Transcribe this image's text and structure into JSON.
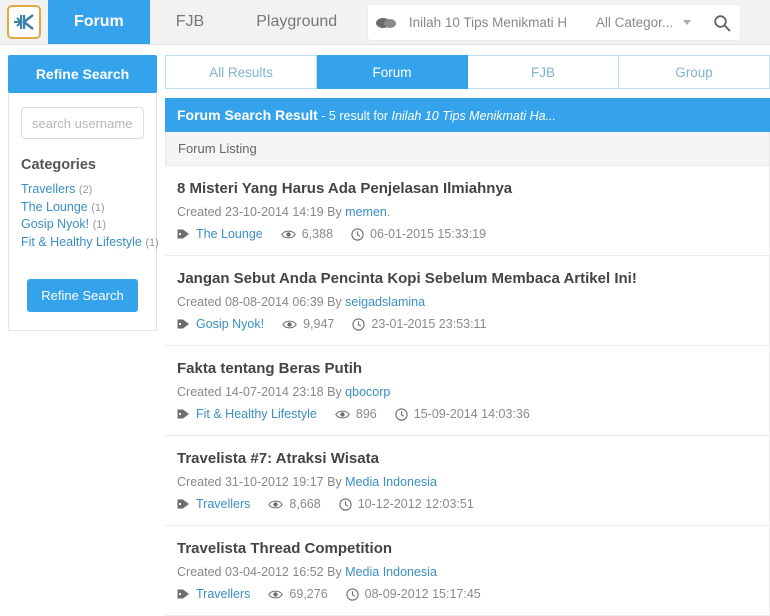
{
  "topnav": {
    "logo_alt": "kaskus-logo",
    "items": [
      {
        "label": "Forum",
        "active": true
      },
      {
        "label": "FJB",
        "active": false
      },
      {
        "label": "Playground",
        "active": false
      }
    ],
    "search": {
      "value": "Inilah 10 Tips Menikmati H",
      "placeholder": "Search",
      "category_label": "All Categor...",
      "chat_icon": "chat-bubble-icon",
      "search_icon": "search-icon"
    }
  },
  "sidebar": {
    "header": "Refine Search",
    "username_placeholder": "search username",
    "username_value": "",
    "categories_title": "Categories",
    "categories": [
      {
        "label": "Travellers",
        "count": "(2)"
      },
      {
        "label": "The Lounge",
        "count": "(1)"
      },
      {
        "label": "Gosip Nyok!",
        "count": "(1)"
      },
      {
        "label": "Fit & Healthy Lifestyle",
        "count": "(1)"
      }
    ],
    "refine_button": "Refine Search"
  },
  "tabs": [
    {
      "label": "All Results",
      "active": false
    },
    {
      "label": "Forum",
      "active": true
    },
    {
      "label": "FJB",
      "active": false
    },
    {
      "label": "Group",
      "active": false
    }
  ],
  "result_header": {
    "title": "Forum Search Result",
    "count_text": " - 5 result for ",
    "query": "Inilah 10 Tips Menikmati Ha..."
  },
  "listing_label": "Forum Listing",
  "threads": [
    {
      "title": "8 Misteri Yang Harus Ada Penjelasan Ilmiahnya",
      "created_prefix": "Created 23-10-2014 14:19 By ",
      "author": "memen",
      "created_suffix": ".",
      "category": "The Lounge",
      "views": "6,388",
      "last_post": "06-01-2015 15:33:19"
    },
    {
      "title": "Jangan Sebut Anda Pencinta Kopi Sebelum Membaca Artikel Ini!",
      "created_prefix": "Created 08-08-2014 06:39 By ",
      "author": "seigadslamina",
      "created_suffix": "",
      "category": "Gosip Nyok!",
      "views": "9,947",
      "last_post": "23-01-2015 23:53:11"
    },
    {
      "title": "Fakta tentang Beras Putih",
      "created_prefix": "Created 14-07-2014 23:18 By ",
      "author": "qbocorp",
      "created_suffix": "",
      "category": "Fit & Healthy Lifestyle",
      "views": "896",
      "last_post": "15-09-2014 14:03:36"
    },
    {
      "title": "Travelista #7: Atraksi Wisata",
      "created_prefix": "Created 31-10-2012 19:17 By ",
      "author": "Media Indonesia",
      "created_suffix": "",
      "category": "Travellers",
      "views": "8,668",
      "last_post": "10-12-2012 12:03:51"
    },
    {
      "title": "Travelista Thread Competition",
      "created_prefix": "Created 03-04-2012 16:52 By ",
      "author": "Media Indonesia",
      "created_suffix": "",
      "category": "Travellers",
      "views": "69,276",
      "last_post": "08-09-2012 15:17:45"
    }
  ],
  "colors": {
    "accent": "#34a3eb",
    "link": "#3a8fc4",
    "logo_border": "#e0a941"
  },
  "icons": {
    "tag": "tag-icon",
    "eye": "eye-icon",
    "clock": "clock-icon"
  }
}
